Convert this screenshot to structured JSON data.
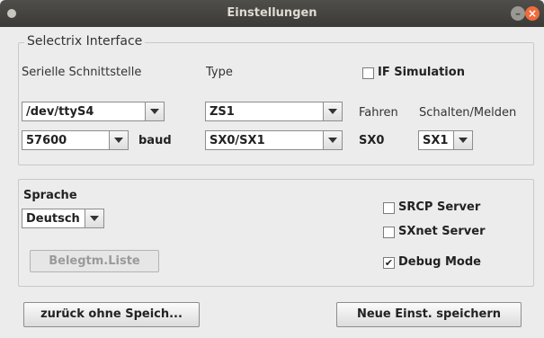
{
  "window": {
    "title": "Einstellungen"
  },
  "selectrix": {
    "legend": "Selectrix Interface",
    "serial_label": "Serielle Schnittstelle",
    "type_label": "Type",
    "if_simulation": {
      "label": "IF Simulation",
      "checked": false
    },
    "port": {
      "value": "/dev/ttyS4"
    },
    "baudrate": {
      "value": "57600"
    },
    "baud_label": "baud",
    "type_fahren": {
      "value": "ZS1"
    },
    "type_bus": {
      "value": "SX0/SX1"
    },
    "fahren_label": "Fahren",
    "schalten_label": "Schalten/Melden",
    "sx0_label": "SX0",
    "schalten_bus": {
      "value": "SX1"
    }
  },
  "general": {
    "sprache_label": "Sprache",
    "language": {
      "value": "Deutsch"
    },
    "belegtm_button": "Belegtm.Liste",
    "srcp_server": {
      "label": "SRCP Server",
      "checked": false
    },
    "sxnet_server": {
      "label": "SXnet Server",
      "checked": false
    },
    "debug_mode": {
      "label": "Debug Mode",
      "checked": true
    }
  },
  "buttons": {
    "back": "zurück ohne Speich...",
    "save": "Neue Einst. speichern"
  }
}
